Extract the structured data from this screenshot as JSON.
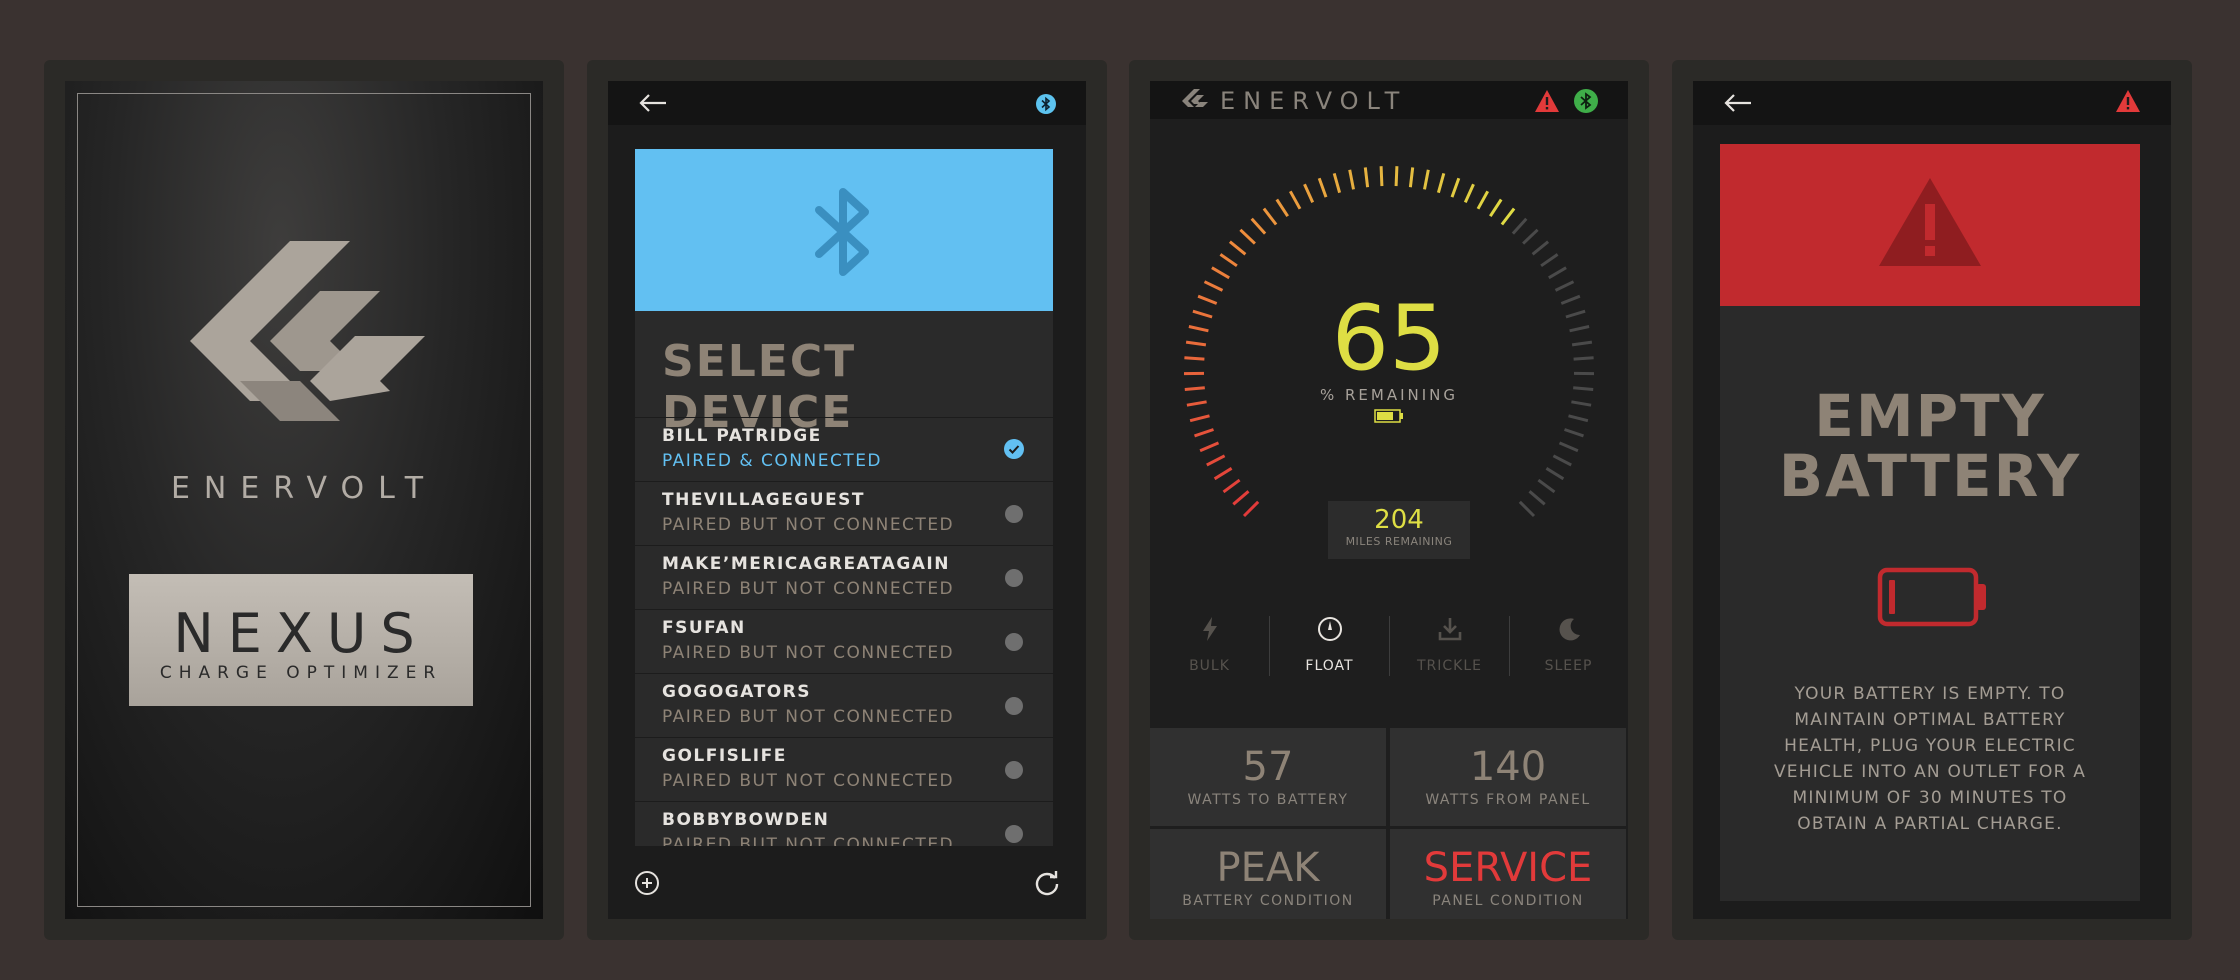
{
  "splash": {
    "brand": "ENERVOLT",
    "product_name": "NEXUS",
    "product_tagline": "CHARGE OPTIMIZER"
  },
  "select_device": {
    "title": "SELECT DEVICE",
    "devices": [
      {
        "name": "BILL PATRIDGE",
        "status": "PAIRED & CONNECTED",
        "connected": true
      },
      {
        "name": "THEVILLAGEGUEST",
        "status": "PAIRED BUT NOT CONNECTED",
        "connected": false
      },
      {
        "name": "MAKE’MERICAGREATAGAIN",
        "status": "PAIRED BUT NOT CONNECTED",
        "connected": false
      },
      {
        "name": "FSUFAN",
        "status": "PAIRED BUT NOT CONNECTED",
        "connected": false
      },
      {
        "name": "GOGOGATORS",
        "status": "PAIRED BUT NOT CONNECTED",
        "connected": false
      },
      {
        "name": "GOLFISLIFE",
        "status": "PAIRED BUT NOT CONNECTED",
        "connected": false
      },
      {
        "name": "BOBBYBOWDEN",
        "status": "PAIRED BUT NOT CONNECTED",
        "connected": false
      }
    ],
    "icons": {
      "back": "back-arrow-icon",
      "bluetooth": "bluetooth-icon",
      "add": "add-icon",
      "refresh": "refresh-icon"
    },
    "accent_color": "#62c0f2"
  },
  "dashboard": {
    "brand": "ENERVOLT",
    "percent_remaining": "65",
    "percent_label": "% REMAINING",
    "miles_value": "204",
    "miles_label": "MILES REMAINING",
    "modes": [
      {
        "label": "BULK",
        "icon": "lightning-icon",
        "active": false
      },
      {
        "label": "FLOAT",
        "icon": "compass-icon",
        "active": true
      },
      {
        "label": "TRICKLE",
        "icon": "download-icon",
        "active": false
      },
      {
        "label": "SLEEP",
        "icon": "moon-icon",
        "active": false
      }
    ],
    "stats": {
      "watts_battery_value": "57",
      "watts_battery_label": "WATTS TO BATTERY",
      "watts_panel_value": "140",
      "watts_panel_label": "WATTS  FROM PANEL",
      "battery_condition_value": "PEAK",
      "battery_condition_label": "BATTERY CONDITION",
      "panel_condition_value": "SERVICE",
      "panel_condition_label": "PANEL CONDITION"
    },
    "gauge_fraction": 0.65,
    "colors": {
      "value": "#dede44",
      "alert": "#e23a3a",
      "connected": "#3fae49"
    }
  },
  "empty_battery": {
    "title_line1": "EMPTY",
    "title_line2": "BATTERY",
    "message": "YOUR BATTERY IS EMPTY. TO MAINTAIN OPTIMAL BATTERY HEALTH, PLUG YOUR ELECTRIC VEHICLE INTO AN OUTLET FOR A MINIMUM OF 30 MINUTES TO OBTAIN A PARTIAL CHARGE.",
    "alert_color": "#c12a2e"
  }
}
